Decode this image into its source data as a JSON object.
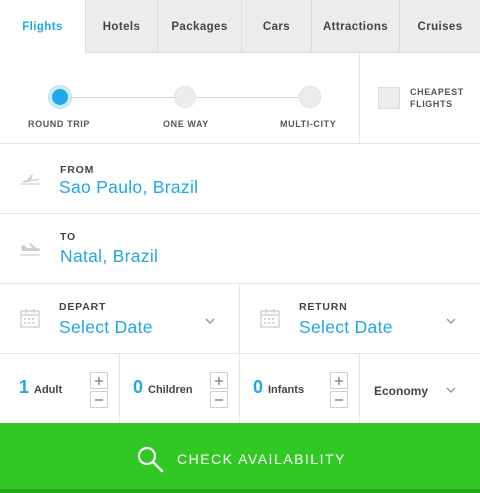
{
  "tabs": [
    {
      "label": "Flights"
    },
    {
      "label": "Hotels"
    },
    {
      "label": "Packages"
    },
    {
      "label": "Cars"
    },
    {
      "label": "Attractions"
    },
    {
      "label": "Cruises"
    }
  ],
  "trip_type": {
    "options": [
      {
        "label": "ROUND TRIP",
        "selected": true
      },
      {
        "label": "ONE WAY",
        "selected": false
      },
      {
        "label": "MULTI-CITY",
        "selected": false
      }
    ]
  },
  "cheapest": {
    "label_line1": "CHEAPEST",
    "label_line2": "FLIGHTS",
    "checked": false
  },
  "from": {
    "label": "FROM",
    "value": "Sao Paulo, Brazil",
    "icon": "plane-takeoff-icon"
  },
  "to": {
    "label": "TO",
    "value": "Natal, Brazil",
    "icon": "plane-landing-icon"
  },
  "depart": {
    "label": "DEPART",
    "value": "Select Date",
    "icon": "calendar-icon"
  },
  "return": {
    "label": "RETURN",
    "value": "Select Date",
    "icon": "calendar-icon"
  },
  "passengers": {
    "adults": {
      "count": "1",
      "label": "Adult"
    },
    "children": {
      "count": "0",
      "label": "Children"
    },
    "infants": {
      "count": "0",
      "label": "Infants"
    }
  },
  "cabin": {
    "value": "Economy"
  },
  "submit": {
    "label": "CHECK AVAILABILITY",
    "icon": "search-icon"
  },
  "colors": {
    "accent": "#1ea8e8",
    "button": "#32c823",
    "tab_bg": "#ececec"
  }
}
